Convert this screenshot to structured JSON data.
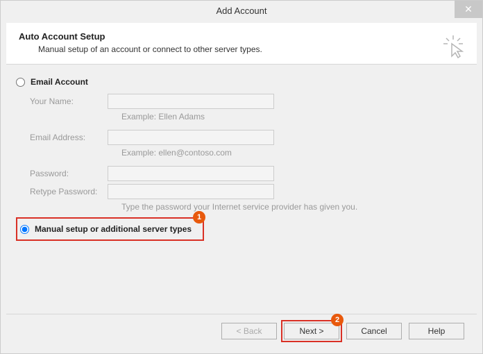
{
  "titlebar": {
    "title": "Add Account",
    "close": "✕"
  },
  "header": {
    "title": "Auto Account Setup",
    "subtitle": "Manual setup of an account or connect to other server types."
  },
  "options": {
    "email_account": {
      "label": "Email Account",
      "selected": false
    },
    "manual_setup": {
      "label": "Manual setup or additional server types",
      "selected": true
    }
  },
  "fields": {
    "your_name": {
      "label": "Your Name:",
      "hint": "Example: Ellen Adams"
    },
    "email": {
      "label": "Email Address:",
      "hint": "Example: ellen@contoso.com"
    },
    "password": {
      "label": "Password:"
    },
    "retype": {
      "label": "Retype Password:",
      "hint": "Type the password your Internet service provider has given you."
    }
  },
  "annotations": {
    "one": "1",
    "two": "2"
  },
  "buttons": {
    "back": "< Back",
    "next": "Next >",
    "cancel": "Cancel",
    "help": "Help"
  }
}
